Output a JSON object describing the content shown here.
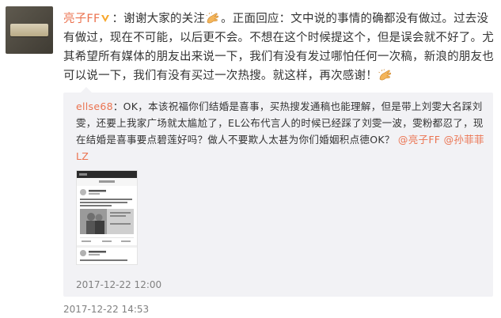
{
  "post": {
    "author": "亮子FF",
    "text_part1": "：谢谢大家的关注",
    "text_part2": "。正面回应：文中说的事情的确都没有做过。过去没有做过，现在不可能，以后更不会。不想在这个时候提这个，但是误会就不好了。尤其希望所有媒体的朋友出来说一下，我们有没有发过哪怕任何一次稿，新浪的朋友也可以说一下，我们有没有买过一次热搜。就这样，再次感谢！",
    "timestamp": "2017-12-22 14:53",
    "emoji_icon": "clapping-hands-icon",
    "badge_icon": "vip-badge-icon"
  },
  "repost": {
    "author": "ellse68",
    "text": "：OK，本该祝福你们结婚是喜事，买热搜发通稿也能理解，但是带上刘雯大名踩刘雯，还要上我家广场就太尴尬了，EL公布代言人的时候已经踩了刘雯一波，雯粉都忍了，现在结婚是喜事要点碧莲好吗？做人不要欺人太甚为你们婚姻积点德OK？",
    "mention1": "@亮子FF",
    "mention2": "@孙菲菲LZ",
    "timestamp": "2017-12-22 12:00"
  },
  "colors": {
    "link": "#eb7350",
    "text": "#333333",
    "meta": "#808080",
    "repost_bg": "#f2f2f5"
  }
}
